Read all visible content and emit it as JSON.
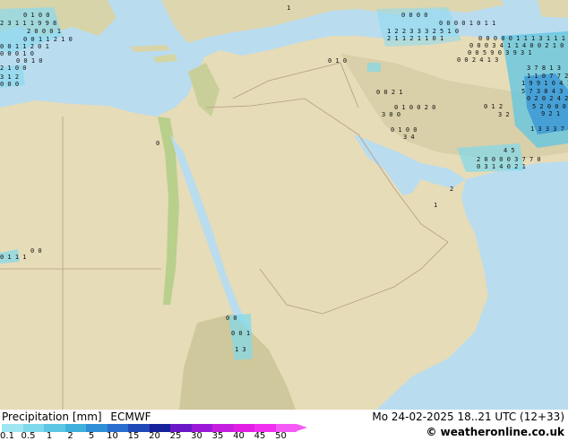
{
  "title": "Precipitation [mm]",
  "model": "ECMWF",
  "valid_time": "Mo 24-02-2025 18..21 UTC (12+33)",
  "copyright": "© weatheronline.co.uk",
  "legend": {
    "labels": [
      "0.1",
      "0.5",
      "1",
      "2",
      "5",
      "10",
      "15",
      "20",
      "25",
      "30",
      "35",
      "40",
      "45",
      "50"
    ],
    "colors": [
      "#9fe6f2",
      "#7fd8ec",
      "#5cc6e4",
      "#3fb0dc",
      "#2f8fd6",
      "#2a6fd0",
      "#2049b8",
      "#14219a",
      "#6a17c8",
      "#9a18d8",
      "#c61ee0",
      "#e21ee6",
      "#f02ff0",
      "#f65af6"
    ]
  },
  "map": {
    "sea_color": "#b9dcef",
    "land_color": "#e6dcb8",
    "precip_values": [
      {
        "text": "0 1 0 0"
      },
      {
        "text": "2 3 1 1 1 9 9 8"
      },
      {
        "text": "2 0 0 0 1"
      },
      {
        "text": "0 0 1 1 2 1 0"
      },
      {
        "text": "0 0 1 1 2   0 1"
      },
      {
        "text": "0 0 0 1 0"
      },
      {
        "text": "0 0 1   0"
      },
      {
        "text": "2 1 0   0"
      },
      {
        "text": "3 1 2"
      },
      {
        "text": "0 0 0"
      },
      {
        "text": "0 0 0 0"
      },
      {
        "text": "1 2 2 3 3 3 2 5 1 0"
      },
      {
        "text": "2 1 1 2 1 1 0   1"
      },
      {
        "text": "0 0 0 0 1 0 1 1"
      },
      {
        "text": "0 0 0 0 0 1 1 1 3 1 1 1 0"
      },
      {
        "text": "0 0 0 3 4 1 1 4 0 0 2 1 0"
      },
      {
        "text": "0 0 5 9 0 3 9 3 1"
      },
      {
        "text": "0 0 2 4 1 3"
      },
      {
        "text": "3 7 8 1 3"
      },
      {
        "text": "1 1 0 7 7 2 1"
      },
      {
        "text": "1 9 9 1 0 4 1"
      },
      {
        "text": "5 7 3 8 4 3"
      },
      {
        "text": "0 2 0 2 4 2"
      },
      {
        "text": "5 2 0 0 0"
      },
      {
        "text": "9 2 1"
      },
      {
        "text": "1 3 3 3 7 9"
      },
      {
        "text": "0 0 2 1"
      },
      {
        "text": "3 0 0"
      },
      {
        "text": "0 1 0 0"
      },
      {
        "text": "3 4"
      },
      {
        "text": "0 1 2"
      },
      {
        "text": "3 2"
      },
      {
        "text": "2 0 0 0 0 3 7 7 0"
      },
      {
        "text": "0 3 1 4   0 2 1"
      },
      {
        "text": "4 5"
      },
      {
        "text": "0 1 1 1"
      },
      {
        "text": "0 0"
      },
      {
        "text": "0 0"
      },
      {
        "text": "0 0 1"
      },
      {
        "text": "1 3"
      },
      {
        "text": "1"
      },
      {
        "text": "0"
      },
      {
        "text": "2"
      },
      {
        "text": "1"
      },
      {
        "text": "0 1 0"
      },
      {
        "text": "0 1 0 0 2 0"
      }
    ]
  }
}
